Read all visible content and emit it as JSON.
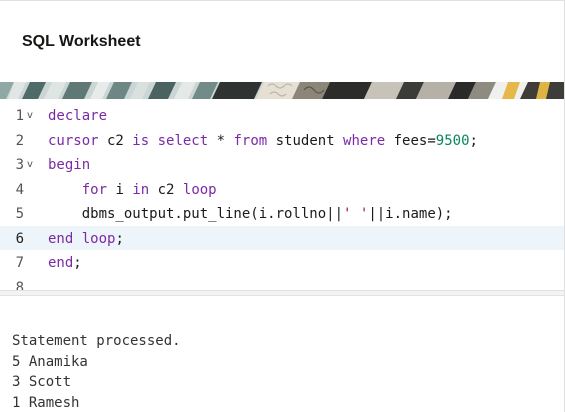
{
  "header": {
    "title": "SQL Worksheet"
  },
  "editor": {
    "lines": [
      {
        "num": "1",
        "fold": "v",
        "tokens": [
          {
            "t": "declare",
            "c": "kw"
          }
        ]
      },
      {
        "num": "2",
        "fold": "",
        "tokens": [
          {
            "t": "cursor",
            "c": "kw"
          },
          {
            "t": " c2 ",
            "c": ""
          },
          {
            "t": "is",
            "c": "kw"
          },
          {
            "t": " ",
            "c": ""
          },
          {
            "t": "select",
            "c": "kw"
          },
          {
            "t": " * ",
            "c": ""
          },
          {
            "t": "from",
            "c": "kw"
          },
          {
            "t": " student ",
            "c": ""
          },
          {
            "t": "where",
            "c": "kw"
          },
          {
            "t": " fees=",
            "c": ""
          },
          {
            "t": "9500",
            "c": "num"
          },
          {
            "t": ";",
            "c": ""
          }
        ]
      },
      {
        "num": "3",
        "fold": "v",
        "tokens": [
          {
            "t": "begin",
            "c": "kw"
          }
        ]
      },
      {
        "num": "4",
        "fold": "",
        "tokens": [
          {
            "t": "    ",
            "c": ""
          },
          {
            "t": "for",
            "c": "kw"
          },
          {
            "t": " i ",
            "c": ""
          },
          {
            "t": "in",
            "c": "kw"
          },
          {
            "t": " c2 ",
            "c": ""
          },
          {
            "t": "loop",
            "c": "kw"
          }
        ]
      },
      {
        "num": "5",
        "fold": "",
        "tokens": [
          {
            "t": "    dbms_output.put_line(i.rollno||",
            "c": ""
          },
          {
            "t": "' '",
            "c": "str"
          },
          {
            "t": "||i.name);",
            "c": ""
          }
        ]
      },
      {
        "num": "6",
        "fold": "",
        "active": true,
        "tokens": [
          {
            "t": "end",
            "c": "kw"
          },
          {
            "t": " ",
            "c": ""
          },
          {
            "t": "loop",
            "c": "kw"
          },
          {
            "t": ";",
            "c": ""
          }
        ]
      },
      {
        "num": "7",
        "fold": "",
        "tokens": [
          {
            "t": "end",
            "c": "kw"
          },
          {
            "t": ";",
            "c": ""
          }
        ]
      },
      {
        "num": "8",
        "fold": "",
        "tokens": []
      }
    ]
  },
  "output": {
    "lines": [
      "Statement processed.",
      "5 Anamika",
      "3 Scott",
      "1 Ramesh"
    ]
  },
  "colors": {
    "keyword": "#7a2aa5",
    "string": "#a31515",
    "number": "#098658",
    "active_line": "#edf4fa"
  }
}
